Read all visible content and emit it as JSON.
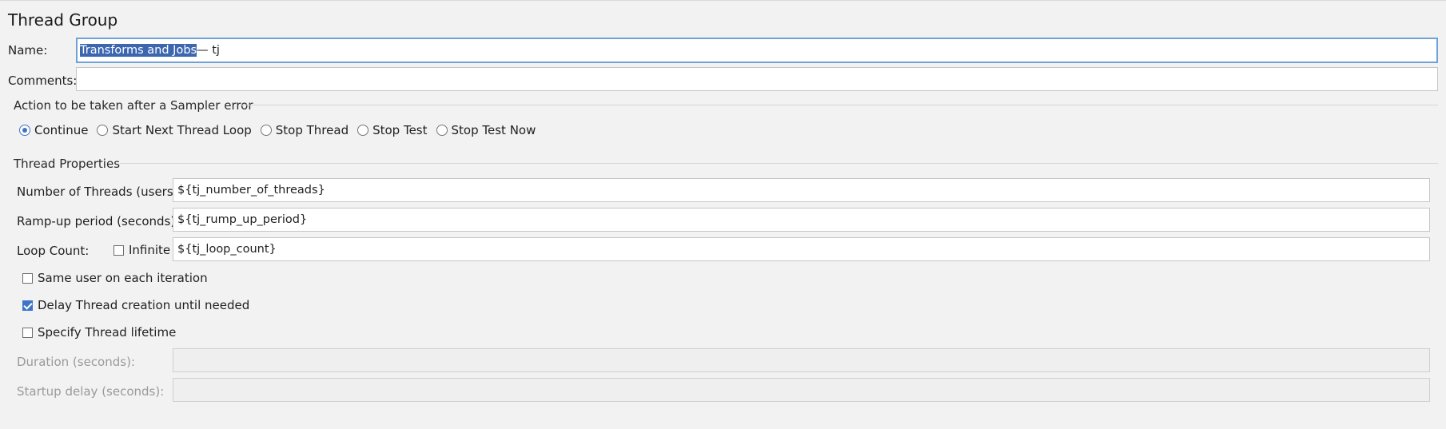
{
  "panel": {
    "title": "Thread Group"
  },
  "name": {
    "label": "Name:",
    "selected_text": "Transforms and Jobs",
    "rest_text": " — tj"
  },
  "comments": {
    "label": "Comments:",
    "value": ""
  },
  "sampler_error": {
    "title": "Action to be taken after a Sampler error",
    "options": [
      {
        "label": "Continue",
        "selected": true
      },
      {
        "label": "Start Next Thread Loop",
        "selected": false
      },
      {
        "label": "Stop Thread",
        "selected": false
      },
      {
        "label": "Stop Test",
        "selected": false
      },
      {
        "label": "Stop Test Now",
        "selected": false
      }
    ]
  },
  "thread_properties": {
    "title": "Thread Properties",
    "num_threads": {
      "label": "Number of Threads (users):",
      "value": "${tj_number_of_threads}"
    },
    "ramp_up": {
      "label": "Ramp-up period (seconds):",
      "value": "${tj_rump_up_period}"
    },
    "loop_count": {
      "label": "Loop Count:",
      "infinite_label": "Infinite",
      "infinite_checked": false,
      "value": "${tj_loop_count}"
    },
    "same_user": {
      "label": "Same user on each iteration",
      "checked": false
    },
    "delay_creation": {
      "label": "Delay Thread creation until needed",
      "checked": true
    },
    "specify_lifetime": {
      "label": "Specify Thread lifetime",
      "checked": false
    },
    "duration": {
      "label": "Duration (seconds):",
      "value": ""
    },
    "startup_delay": {
      "label": "Startup delay (seconds):",
      "value": ""
    }
  }
}
